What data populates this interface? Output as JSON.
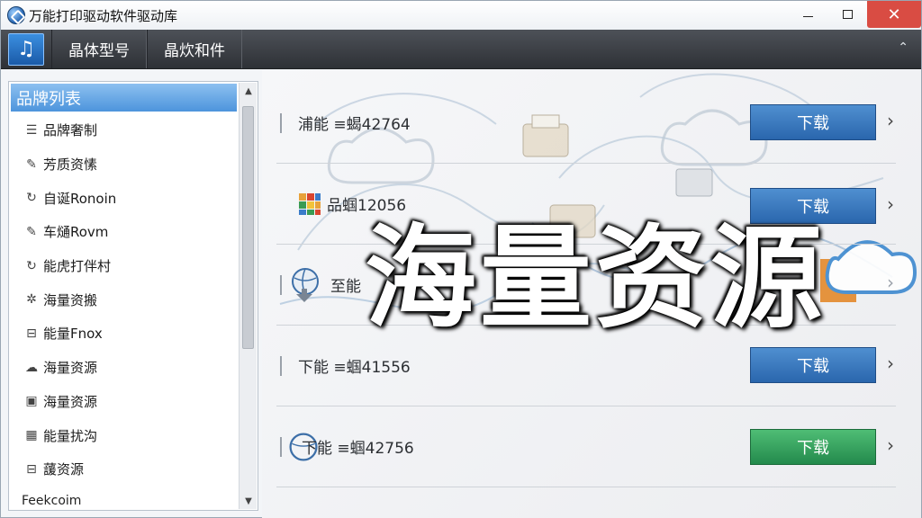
{
  "window": {
    "title": "万能打印驱动软件驱动库",
    "close_glyph": "✕"
  },
  "toolbar": {
    "logo_glyph": "♫",
    "tabs": [
      "晶体型号",
      "晶炊和件"
    ],
    "collapse_glyph": "⌃"
  },
  "sidebar": {
    "header": "品牌列表",
    "items": [
      {
        "icon": "list-icon",
        "glyph": "☰",
        "label": "品牌奢制"
      },
      {
        "icon": "edit-icon",
        "glyph": "✎",
        "label": "芳质资愫"
      },
      {
        "icon": "refresh-icon",
        "glyph": "↻",
        "label": "自诞Ronoin"
      },
      {
        "icon": "edit-icon",
        "glyph": "✎",
        "label": "车熥Rovm"
      },
      {
        "icon": "refresh-icon",
        "glyph": "↻",
        "label": "能虎打伴村"
      },
      {
        "icon": "gear-icon",
        "glyph": "✲",
        "label": "海量资搬"
      },
      {
        "icon": "printer-icon",
        "glyph": "⊟",
        "label": "能量Fnox"
      },
      {
        "icon": "cloud-icon",
        "glyph": "☁",
        "label": "海量资源"
      },
      {
        "icon": "window-icon",
        "glyph": "▣",
        "label": "海量资源"
      },
      {
        "icon": "grid-icon",
        "glyph": "▦",
        "label": "能量扰沟"
      },
      {
        "icon": "printer-icon",
        "glyph": "⊟",
        "label": "蘐资源"
      }
    ],
    "footer": "Feekcoim"
  },
  "list": {
    "rows": [
      {
        "name": "浦能 ≡蝎42764",
        "button": "下载",
        "style": "blue",
        "icon": "none"
      },
      {
        "name": "品蝈12056",
        "button": "下载",
        "style": "blue",
        "icon": "colorful-grid-icon"
      },
      {
        "name": "至能",
        "button": "",
        "style": "none",
        "icon": "globe-download-icon"
      },
      {
        "name": "下能 ≡蝈41556",
        "button": "下载",
        "style": "blue",
        "icon": "none"
      },
      {
        "name": "下能 ≡蝈42756",
        "button": "下载",
        "style": "green",
        "icon": "globe-icon"
      }
    ],
    "chevron": "›"
  },
  "overlay_text": "海量资源",
  "colors": {
    "accent_blue": "#2a66ad",
    "accent_green": "#238a4c",
    "toolbar_dark": "#2e3136",
    "sidebar_header": "#4d94dc",
    "close_red": "#d94c43"
  }
}
